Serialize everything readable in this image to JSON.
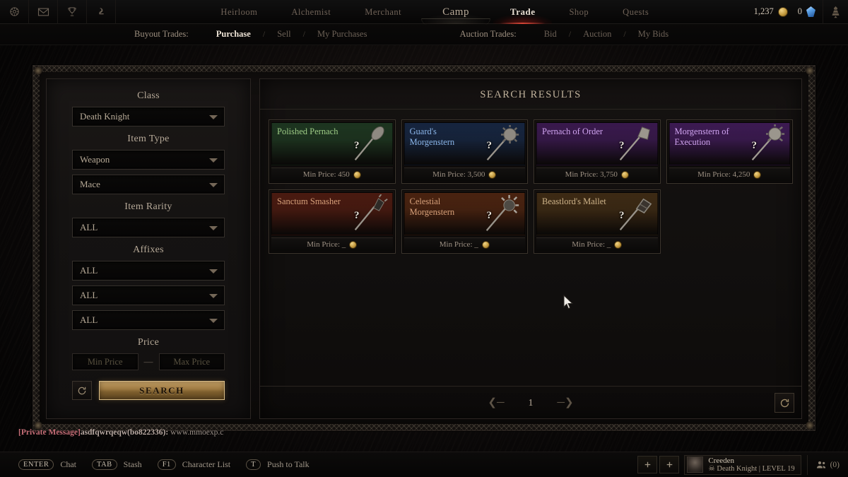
{
  "topbar": {
    "icons": [
      {
        "name": "compass-icon"
      },
      {
        "name": "mail-icon"
      },
      {
        "name": "trophy-icon"
      },
      {
        "name": "pet-icon"
      }
    ],
    "nav": [
      {
        "label": "Heirloom",
        "state": "normal"
      },
      {
        "label": "Alchemist",
        "state": "normal"
      },
      {
        "label": "Merchant",
        "state": "normal"
      },
      {
        "label": "Camp",
        "state": "camp"
      },
      {
        "label": "Trade",
        "state": "active"
      },
      {
        "label": "Shop",
        "state": "normal"
      },
      {
        "label": "Quests",
        "state": "normal"
      }
    ],
    "gold": "1,237",
    "gems": "0",
    "gold_icon": "gold-coin-icon",
    "gem_icon": "blue-gem-icon",
    "settings_icon": "ornament-icon"
  },
  "subnav": {
    "buyout_label": "Buyout Trades:",
    "buyout_items": [
      "Purchase",
      "Sell",
      "My Purchases"
    ],
    "buyout_active": "Purchase",
    "auction_label": "Auction Trades:",
    "auction_items": [
      "Bid",
      "Auction",
      "My Bids"
    ],
    "separator": "/"
  },
  "filters": {
    "class_label": "Class",
    "class_value": "Death Knight",
    "item_type_label": "Item Type",
    "item_type_value": "Weapon",
    "item_subtype_value": "Mace",
    "rarity_label": "Item Rarity",
    "rarity_value": "ALL",
    "affixes_label": "Affixes",
    "affix1_value": "ALL",
    "affix2_value": "ALL",
    "affix3_value": "ALL",
    "price_label": "Price",
    "min_price_placeholder": "Min Price",
    "max_price_placeholder": "Max Price",
    "price_dash": "—",
    "reset_icon": "reset-icon",
    "search_label": "SEARCH"
  },
  "results": {
    "title": "SEARCH RESULTS",
    "price_prefix": "Min Price:",
    "items": [
      {
        "name": "Polished Pernach",
        "price": "450",
        "rarity": "uncommon",
        "bg": "#1d3520",
        "fg": "#9ecb86",
        "weapon": "pernach"
      },
      {
        "name": "Guard's Morgenstern",
        "price": "3,500",
        "rarity": "rare",
        "bg": "#16253f",
        "fg": "#8bb5e8",
        "weapon": "morgenstern"
      },
      {
        "name": "Pernach of Order",
        "price": "3,750",
        "rarity": "epic",
        "bg": "#39194d",
        "fg": "#cfa3ef",
        "weapon": "pernach2"
      },
      {
        "name": "Morgenstern of Execution",
        "price": "4,250",
        "rarity": "epic",
        "bg": "#3c1a52",
        "fg": "#cfa3ef",
        "weapon": "morgenstern2"
      },
      {
        "name": "Sanctum Smasher",
        "price": "_",
        "rarity": "legendary",
        "bg": "#4a1a10",
        "fg": "#d6a07a",
        "weapon": "spiked"
      },
      {
        "name": "Celestial Morgenstern",
        "price": "_",
        "rarity": "legendary",
        "bg": "#4a2310",
        "fg": "#d6a07a",
        "weapon": "celestial"
      },
      {
        "name": "Beastlord's Mallet",
        "price": "_",
        "rarity": "legendary",
        "bg": "#3d2a14",
        "fg": "#cfb48a",
        "weapon": "mallet"
      }
    ],
    "unknown_marker": "?",
    "page_number": "1",
    "prev_icon": "prev-arrow-icon",
    "next_icon": "next-arrow-icon",
    "refresh_icon": "refresh-icon"
  },
  "chat": {
    "tag": "[Private Message]",
    "sender": "asdfqwrqeqw(bo822336):",
    "message": "www.mmoexp.c"
  },
  "bottombar": {
    "hotkeys": [
      {
        "key": "ENTER",
        "label": "Chat"
      },
      {
        "key": "TAB",
        "label": "Stash"
      },
      {
        "key": "F1",
        "label": "Character List"
      },
      {
        "key": "T",
        "label": "Push to Talk"
      }
    ],
    "add_icon": "plus-icon",
    "player_name": "Creeden",
    "player_class": "Death Knight",
    "player_level": "LEVEL 19",
    "class_sep": "|",
    "party_icon": "party-icon",
    "party_count": "(0)"
  },
  "cursor": {
    "icon": "mouse-cursor-icon"
  }
}
